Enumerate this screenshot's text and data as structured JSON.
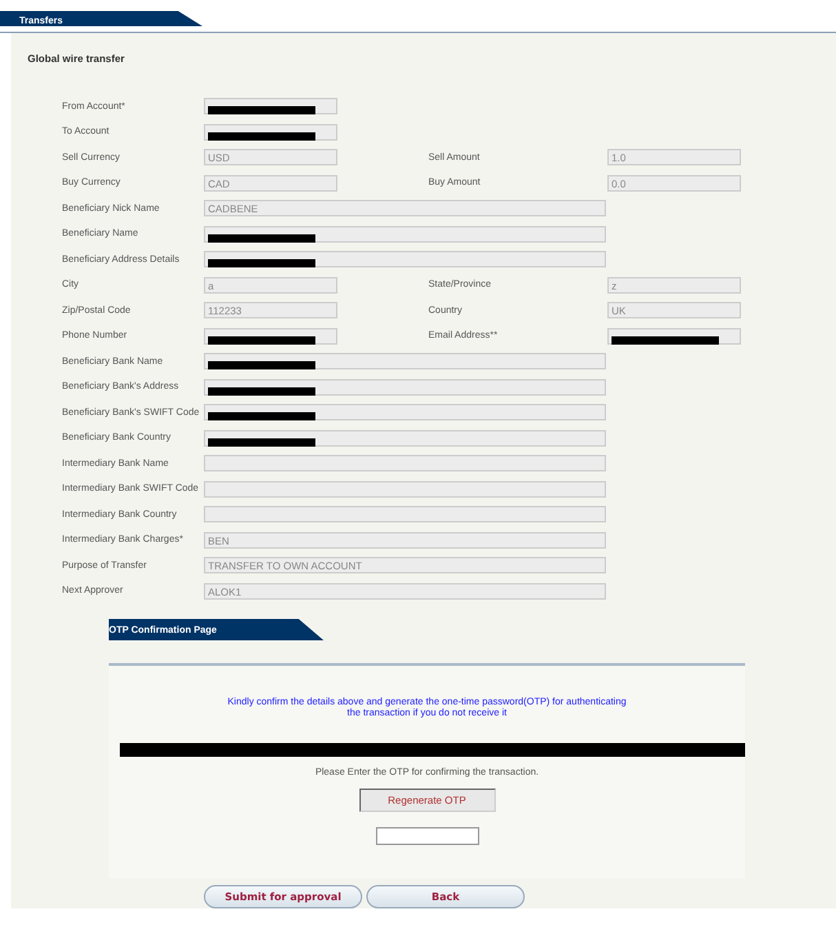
{
  "tabs": [
    {
      "label": "Transfers",
      "selected": true
    }
  ],
  "form": {
    "title": "Global wire transfer",
    "rows": [
      {
        "kind": "short",
        "fields": [
          {
            "label": "From Account*",
            "redacted": true
          }
        ]
      },
      {
        "kind": "short",
        "fields": [
          {
            "label": "To Account",
            "redacted": true
          }
        ]
      },
      {
        "kind": "pair",
        "fields": [
          {
            "label": "Sell Currency",
            "value": "USD",
            "redacted": false
          },
          {
            "label": "Sell Amount",
            "value": "1.0",
            "redacted": false
          }
        ]
      },
      {
        "kind": "pair",
        "fields": [
          {
            "label": "Buy Currency",
            "value": "CAD",
            "redacted": false
          },
          {
            "label": "Buy Amount",
            "value": "0.0",
            "redacted": false
          }
        ]
      },
      {
        "kind": "wide",
        "fields": [
          {
            "label": "Beneficiary Nick Name",
            "value": "CADBENE",
            "redacted": false
          }
        ]
      },
      {
        "kind": "wide",
        "fields": [
          {
            "label": "Beneficiary Name",
            "redacted": true
          }
        ]
      },
      {
        "kind": "wide",
        "fields": [
          {
            "label": "Beneficiary Address Details",
            "redacted": true
          }
        ]
      },
      {
        "kind": "pair",
        "fields": [
          {
            "label": "City",
            "value": "a",
            "redacted": false
          },
          {
            "label": "State/Province",
            "value": "z",
            "redacted": false
          }
        ]
      },
      {
        "kind": "pair",
        "fields": [
          {
            "label": "Zip/Postal Code",
            "value": "112233",
            "redacted": false
          },
          {
            "label": "Country",
            "value": "UK",
            "redacted": false
          }
        ]
      },
      {
        "kind": "pair",
        "fields": [
          {
            "label": "Phone Number",
            "redacted": true
          },
          {
            "label": "Email Address**",
            "redacted": true
          }
        ]
      },
      {
        "kind": "wide",
        "fields": [
          {
            "label": "Beneficiary Bank Name",
            "redacted": true
          }
        ]
      },
      {
        "kind": "wide",
        "fields": [
          {
            "label": "Beneficiary Bank's Address",
            "redacted": true
          }
        ]
      },
      {
        "kind": "wide",
        "fields": [
          {
            "label": "Beneficiary Bank's SWIFT Code",
            "redacted": true
          }
        ]
      },
      {
        "kind": "wide",
        "fields": [
          {
            "label": "Beneficiary Bank Country",
            "redacted": true
          }
        ]
      },
      {
        "kind": "wide",
        "fields": [
          {
            "label": "Intermediary Bank Name",
            "redacted": false
          }
        ]
      },
      {
        "kind": "wide",
        "fields": [
          {
            "label": "Intermediary Bank SWIFT Code",
            "redacted": false
          }
        ]
      },
      {
        "kind": "wide",
        "fields": [
          {
            "label": "Intermediary Bank Country",
            "redacted": false
          }
        ]
      },
      {
        "kind": "wide",
        "fields": [
          {
            "label": "Intermediary Bank Charges*",
            "value": "BEN",
            "redacted": false
          }
        ]
      },
      {
        "kind": "wide",
        "fields": [
          {
            "label": "Purpose of Transfer",
            "value": "TRANSFER TO OWN ACCOUNT",
            "redacted": false
          }
        ]
      },
      {
        "kind": "wide",
        "fields": [
          {
            "label": "Next Approver",
            "value": "ALOK1",
            "redacted": false
          }
        ]
      }
    ]
  },
  "otp": {
    "heading": "OTP Confirmation Page",
    "notice": "Kindly confirm the details above and generate the one-time password(OTP) for authenticating the transaction if you do not receive it",
    "message_redacted": true,
    "instruction": "Please Enter the OTP for confirming the transaction.",
    "regenerate_button": "Regenerate OTP"
  },
  "buttons": [
    "Submit for approval",
    "Back"
  ]
}
